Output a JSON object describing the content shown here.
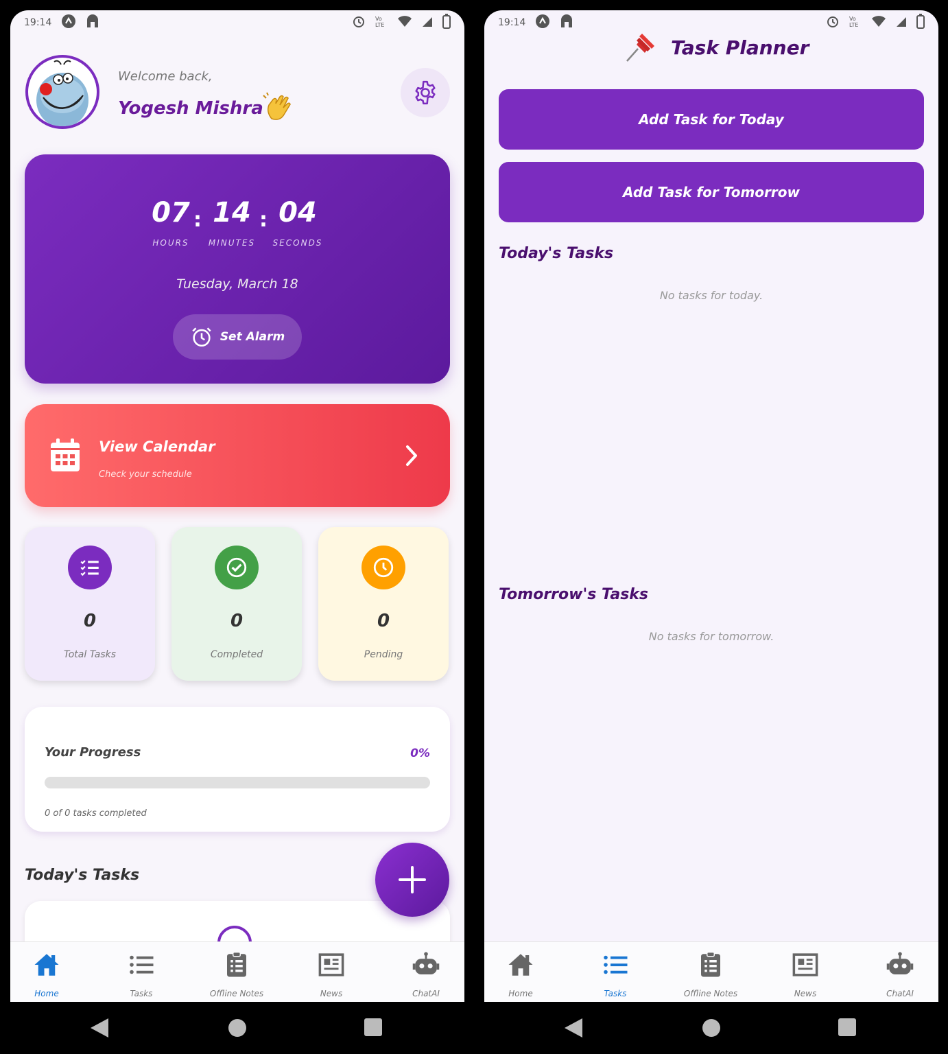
{
  "status_bar": {
    "time": "19:14"
  },
  "home": {
    "welcome": "Welcome back,",
    "user_name": "Yogesh Mishra",
    "clock": {
      "hours": "07",
      "minutes": "14",
      "seconds": "04",
      "hours_label": "HOURS",
      "minutes_label": "MINUTES",
      "seconds_label": "SECONDS",
      "date": "Tuesday, March 18"
    },
    "set_alarm_label": "Set Alarm",
    "calendar": {
      "title": "View Calendar",
      "subtitle": "Check your schedule"
    },
    "stats": [
      {
        "value": "0",
        "label": "Total Tasks",
        "color": "#7b2cbf",
        "bg": "#f1e9fb",
        "icon": "checklist-icon"
      },
      {
        "value": "0",
        "label": "Completed",
        "color": "#43a047",
        "bg": "#e8f4e9",
        "icon": "check-circle-icon"
      },
      {
        "value": "0",
        "label": "Pending",
        "color": "#ffa000",
        "bg": "#fff8e1",
        "icon": "clock-icon"
      }
    ],
    "progress": {
      "title": "Your Progress",
      "percent": "0%",
      "value": 0,
      "summary": "0 of 0 tasks completed"
    },
    "todays_tasks_heading": "Today's Tasks"
  },
  "planner": {
    "title": "Task Planner",
    "add_today_label": "Add Task for Today",
    "add_tomorrow_label": "Add Task for Tomorrow",
    "today_heading": "Today's Tasks",
    "today_empty": "No tasks for today.",
    "tomorrow_heading": "Tomorrow's Tasks",
    "tomorrow_empty": "No tasks for tomorrow."
  },
  "nav": {
    "items": [
      {
        "label": "Home",
        "icon": "home-icon"
      },
      {
        "label": "Tasks",
        "icon": "list-icon"
      },
      {
        "label": "Offline Notes",
        "icon": "clipboard-icon"
      },
      {
        "label": "News",
        "icon": "newspaper-icon"
      },
      {
        "label": "ChatAI",
        "icon": "robot-icon"
      }
    ],
    "left_active": "Home",
    "right_active": "Tasks"
  },
  "colors": {
    "primary": "#7b2cbf",
    "accent_blue": "#1976d2",
    "calendar_red": "#ee3a4a"
  }
}
